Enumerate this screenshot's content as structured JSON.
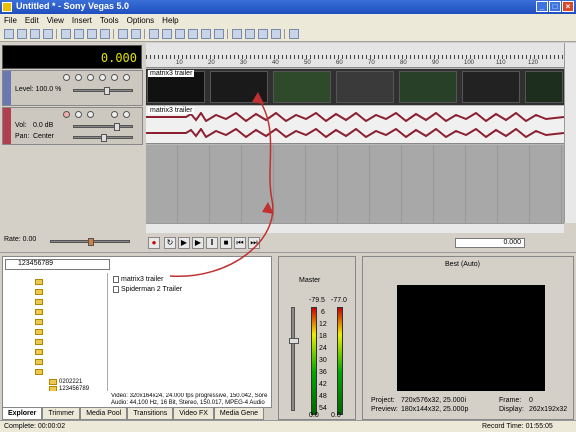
{
  "window": {
    "title": "Untitled * - Sony Vegas 5.0",
    "buttons": [
      "_",
      "□",
      "×"
    ]
  },
  "menu": [
    "File",
    "Edit",
    "View",
    "Insert",
    "Tools",
    "Options",
    "Help"
  ],
  "time_display": "0.000",
  "video_track": {
    "level_label": "Level: 100.0 %"
  },
  "audio_track": {
    "vol_label": "Vol:",
    "vol_value": "0.0 dB",
    "pan_label": "Pan:",
    "pan_value": "Center"
  },
  "ruler_ticks": [
    "10",
    "20",
    "30",
    "40",
    "50",
    "60",
    "70",
    "80",
    "90",
    "100",
    "110",
    "120"
  ],
  "clips": {
    "video": "matrix3 trailer",
    "audio": "matrix3 trailer"
  },
  "transport": {
    "rate_label": "Rate: 0.00",
    "time": "0.000"
  },
  "explorer": {
    "path": "123456789",
    "tree_folders": [
      "0202221",
      "123456789"
    ],
    "files": [
      "matrix3 trailer",
      "Spiderman 2 Trailer"
    ],
    "file_info": [
      "Video: 320x164x24, 24.000 fps progressive, 150.042, Sore",
      "Audio: 44,100 Hz, 16 Bit, Stereo, 150.017, MPEG-4 Audio"
    ]
  },
  "tabs": [
    "Explorer",
    "Trimmer",
    "Media Pool",
    "Transitions",
    "Video FX",
    "Media Gene"
  ],
  "mixer": {
    "title": "Master",
    "left_db": "-79.5",
    "right_db": "-77.0",
    "scale": [
      "6",
      "12",
      "18",
      "24",
      "30",
      "36",
      "42",
      "48",
      "54"
    ],
    "bottom_left": "0.0",
    "bottom_right": "0.0"
  },
  "preview": {
    "quality": "Best (Auto)",
    "project_label": "Project:",
    "project_value": "720x576x32, 25.000i",
    "preview_label": "Preview:",
    "preview_value": "180x144x32, 25.000p",
    "frame_label": "Frame:",
    "frame_value": "0",
    "display_label": "Display:",
    "display_value": "262x192x32"
  },
  "status": {
    "left": "Complete: 00:00:02",
    "right": "Record Time: 01:55:05"
  },
  "colors": {
    "accent_red": "#c03030",
    "title_blue": "#1f4fbf"
  }
}
